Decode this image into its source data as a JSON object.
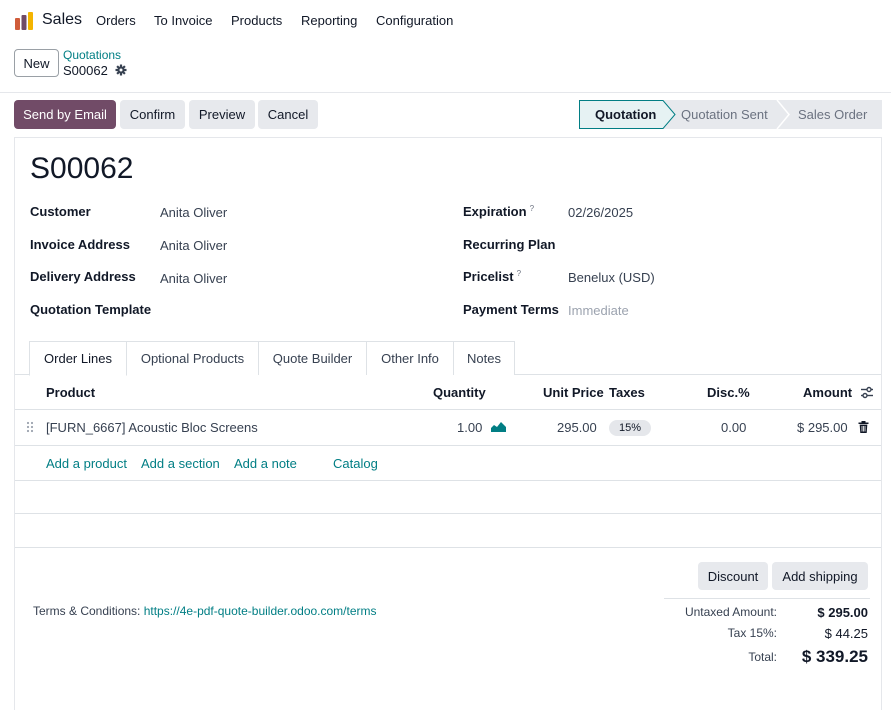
{
  "nav": {
    "app_name": "Sales",
    "menu": [
      "Orders",
      "To Invoice",
      "Products",
      "Reporting",
      "Configuration"
    ]
  },
  "control": {
    "new_label": "New",
    "breadcrumb": "Quotations",
    "record_name": "S00062"
  },
  "actions": {
    "send_email": "Send by Email",
    "confirm": "Confirm",
    "preview": "Preview",
    "cancel": "Cancel"
  },
  "status": {
    "steps": [
      "Quotation",
      "Quotation Sent",
      "Sales Order"
    ],
    "active": "Quotation"
  },
  "form": {
    "title": "S00062",
    "customer_label": "Customer",
    "customer": "Anita Oliver",
    "invoice_address_label": "Invoice Address",
    "invoice_address": "Anita Oliver",
    "delivery_address_label": "Delivery Address",
    "delivery_address": "Anita Oliver",
    "quotation_template_label": "Quotation Template",
    "expiration_label": "Expiration",
    "expiration": "02/26/2025",
    "recurring_plan_label": "Recurring Plan",
    "pricelist_label": "Pricelist",
    "pricelist": "Benelux (USD)",
    "payment_terms_label": "Payment Terms",
    "payment_terms_placeholder": "Immediate",
    "help_mark": "?"
  },
  "tabs": [
    "Order Lines",
    "Optional Products",
    "Quote Builder",
    "Other Info",
    "Notes"
  ],
  "table": {
    "headers": {
      "product": "Product",
      "quantity": "Quantity",
      "unit_price": "Unit Price",
      "taxes": "Taxes",
      "discount": "Disc.%",
      "amount": "Amount"
    },
    "rows": [
      {
        "product": "[FURN_6667] Acoustic Bloc Screens",
        "quantity": "1.00",
        "unit_price": "295.00",
        "tax": "15%",
        "discount": "0.00",
        "amount": "$ 295.00"
      }
    ],
    "add_product": "Add a product",
    "add_section": "Add a section",
    "add_note": "Add a note",
    "catalog": "Catalog"
  },
  "footer": {
    "discount": "Discount",
    "add_shipping": "Add shipping",
    "terms_label": "Terms & Conditions:",
    "terms_link": "https://4e-pdf-quote-builder.odoo.com/terms",
    "untaxed_label": "Untaxed Amount:",
    "untaxed": "$ 295.00",
    "tax_label": "Tax 15%:",
    "tax": "$ 44.25",
    "total_label": "Total:",
    "total": "$ 339.25"
  },
  "colors": {
    "primary": "#714b67",
    "link": "#017e84",
    "status_active_bg": "#e6f2f3"
  }
}
